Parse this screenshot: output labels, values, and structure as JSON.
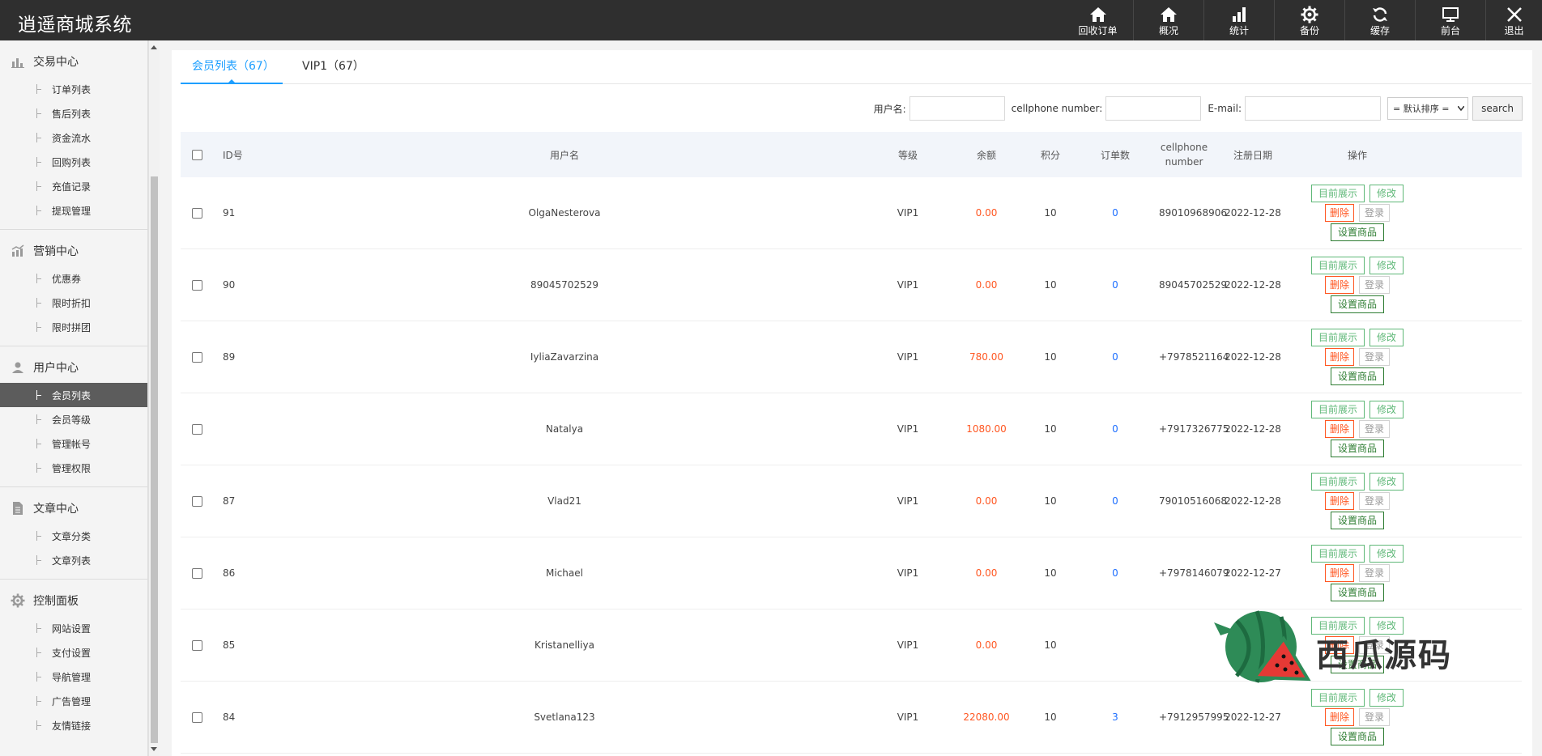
{
  "app": {
    "title": "逍遥商城系统"
  },
  "topnav": [
    {
      "label": "回收订单",
      "icon": "home-icon"
    },
    {
      "label": "概况",
      "icon": "home-icon"
    },
    {
      "label": "统计",
      "icon": "bar-chart-icon"
    },
    {
      "label": "备份",
      "icon": "gear-icon"
    },
    {
      "label": "缓存",
      "icon": "refresh-icon"
    },
    {
      "label": "前台",
      "icon": "monitor-icon"
    },
    {
      "label": "退出",
      "icon": "close-icon"
    }
  ],
  "sidebar": {
    "groups": [
      {
        "title": "交易中心",
        "icon": "bar-chart-icon",
        "items": [
          "订单列表",
          "售后列表",
          "资金流水",
          "回购列表",
          "充值记录",
          "提现管理"
        ]
      },
      {
        "title": "营销中心",
        "icon": "chart-icon",
        "items": [
          "优惠券",
          "限时折扣",
          "限时拼团"
        ]
      },
      {
        "title": "用户中心",
        "icon": "user-icon",
        "items": [
          "会员列表",
          "会员等级",
          "管理帐号",
          "管理权限"
        ]
      },
      {
        "title": "文章中心",
        "icon": "document-icon",
        "items": [
          "文章分类",
          "文章列表"
        ]
      },
      {
        "title": "控制面板",
        "icon": "gear-icon",
        "items": [
          "网站设置",
          "支付设置",
          "导航管理",
          "广告管理",
          "友情链接"
        ]
      }
    ],
    "active_item": "会员列表"
  },
  "tabs": [
    {
      "label": "会员列表（67）",
      "active": true
    },
    {
      "label": "VIP1（67）",
      "active": false
    }
  ],
  "filter": {
    "username_label": "用户名:",
    "phone_label": "cellphone number:",
    "email_label": "E-mail:",
    "sort_label": "= 默认排序 =",
    "search_label": "search"
  },
  "table": {
    "headers": {
      "id": "ID号",
      "username": "用户名",
      "level": "等级",
      "balance": "余额",
      "points": "积分",
      "orders": "订单数",
      "phone": "cellphone number",
      "date": "注册日期",
      "actions": "操作"
    },
    "action_labels": {
      "front": "目前展示",
      "edit": "修改",
      "delete": "删除",
      "login": "登录",
      "set": "设置商品"
    },
    "rows": [
      {
        "id": "91",
        "username": "OlgaNesterova",
        "level": "VIP1",
        "balance": "0.00",
        "points": "10",
        "orders": "0",
        "phone": "89010968906",
        "date": "2022-12-28"
      },
      {
        "id": "90",
        "username": "89045702529",
        "level": "VIP1",
        "balance": "0.00",
        "points": "10",
        "orders": "0",
        "phone": "89045702529",
        "date": "2022-12-28"
      },
      {
        "id": "89",
        "username": "IyliaZavarzina",
        "level": "VIP1",
        "balance": "780.00",
        "points": "10",
        "orders": "0",
        "phone": "+7978521164",
        "date": "2022-12-28"
      },
      {
        "id": "",
        "username": "Natalya",
        "level": "VIP1",
        "balance": "1080.00",
        "points": "10",
        "orders": "0",
        "phone": "+7917326775",
        "date": "2022-12-28"
      },
      {
        "id": "87",
        "username": "Vlad21",
        "level": "VIP1",
        "balance": "0.00",
        "points": "10",
        "orders": "0",
        "phone": "79010516068",
        "date": "2022-12-28"
      },
      {
        "id": "86",
        "username": "Michael",
        "level": "VIP1",
        "balance": "0.00",
        "points": "10",
        "orders": "0",
        "phone": "+7978146079",
        "date": "2022-12-27"
      },
      {
        "id": "85",
        "username": "Kristanelliya",
        "level": "VIP1",
        "balance": "0.00",
        "points": "10",
        "orders": "",
        "phone": "",
        "date": ""
      },
      {
        "id": "84",
        "username": "Svetlana123",
        "level": "VIP1",
        "balance": "22080.00",
        "points": "10",
        "orders": "3",
        "phone": "+7912957995",
        "date": "2022-12-27"
      }
    ]
  },
  "watermark": {
    "text": "西瓜源码"
  },
  "colors": {
    "topbar": "#2f2f2f",
    "accent": "#1e9fff",
    "orange": "#ff5722",
    "green": "#5fb878"
  }
}
